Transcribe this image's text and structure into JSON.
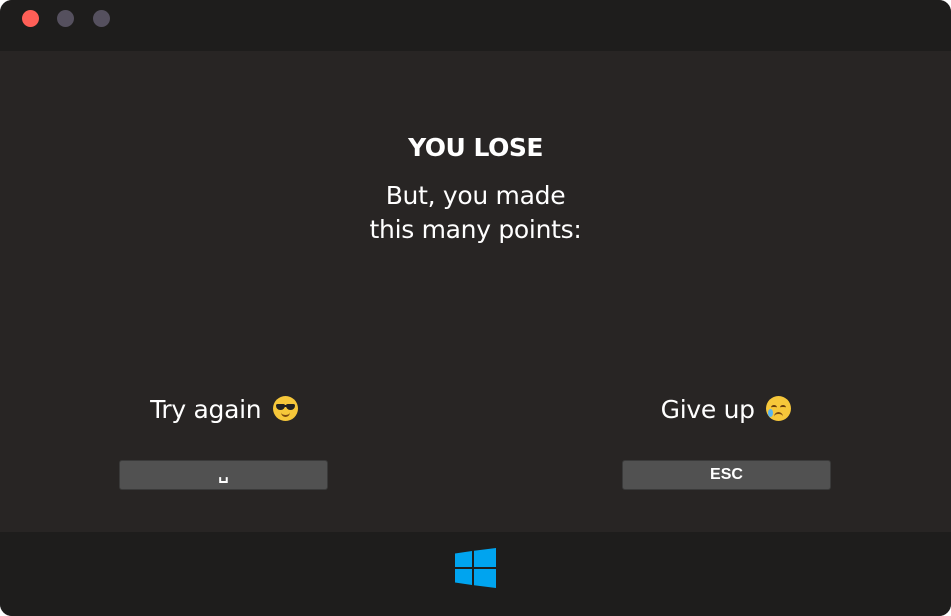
{
  "window": {
    "controls": [
      "close",
      "minimize",
      "maximize"
    ]
  },
  "game_over": {
    "headline": "YOU LOSE",
    "subline_1": "But, you made",
    "subline_2": "this many points:"
  },
  "options": {
    "retry": {
      "label": "Try again",
      "emoji": "smiling-face-with-sunglasses-icon",
      "key": "␣"
    },
    "quit": {
      "label": "Give up",
      "emoji": "crying-face-icon",
      "key": "ESC"
    }
  },
  "taskbar": {
    "start_icon": "windows-logo-icon",
    "accent": "#00a4ef"
  },
  "colors": {
    "background": "#282524",
    "bars": "#1e1d1c",
    "close_dot": "#ff5f57",
    "key_button": "#515151"
  }
}
